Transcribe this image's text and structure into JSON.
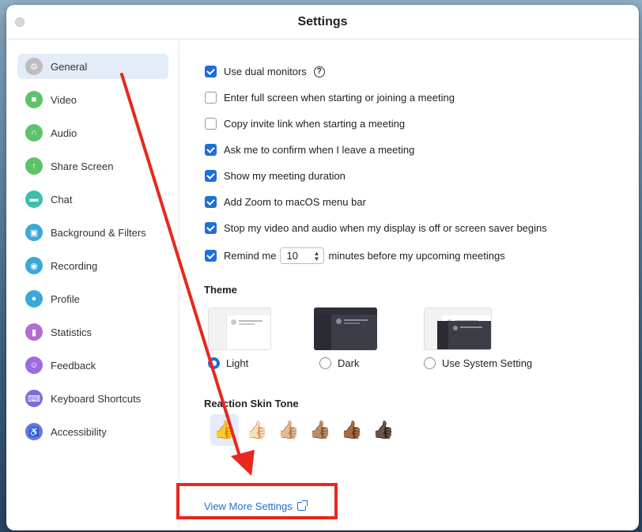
{
  "window": {
    "title": "Settings"
  },
  "sidebar": {
    "items": [
      {
        "label": "General",
        "icon": "gear-icon",
        "color": "#bdbdbd"
      },
      {
        "label": "Video",
        "icon": "video-icon",
        "color": "#5cc36b"
      },
      {
        "label": "Audio",
        "icon": "headphones-icon",
        "color": "#5cc36b"
      },
      {
        "label": "Share Screen",
        "icon": "share-screen-icon",
        "color": "#5cc36b"
      },
      {
        "label": "Chat",
        "icon": "chat-icon",
        "color": "#3fbfaa"
      },
      {
        "label": "Background & Filters",
        "icon": "background-icon",
        "color": "#3aa8d8"
      },
      {
        "label": "Recording",
        "icon": "recording-icon",
        "color": "#3aa8d8"
      },
      {
        "label": "Profile",
        "icon": "profile-icon",
        "color": "#3aa8d8"
      },
      {
        "label": "Statistics",
        "icon": "statistics-icon",
        "color": "#b36ccf"
      },
      {
        "label": "Feedback",
        "icon": "feedback-icon",
        "color": "#9a6cdf"
      },
      {
        "label": "Keyboard Shortcuts",
        "icon": "keyboard-icon",
        "color": "#7b6cdf"
      },
      {
        "label": "Accessibility",
        "icon": "accessibility-icon",
        "color": "#6c72df"
      }
    ]
  },
  "general": {
    "options": [
      {
        "label": "Use dual monitors",
        "checked": true
      },
      {
        "label": "Enter full screen when starting or joining a meeting",
        "checked": false
      },
      {
        "label": "Copy invite link when starting a meeting",
        "checked": false
      },
      {
        "label": "Ask me to confirm when I leave a meeting",
        "checked": true
      },
      {
        "label": "Show my meeting duration",
        "checked": true
      },
      {
        "label": "Add Zoom to macOS menu bar",
        "checked": true
      },
      {
        "label": "Stop my video and audio when my display is off or screen saver begins",
        "checked": true
      }
    ],
    "remind": {
      "before": "Remind me",
      "value": "10",
      "after": "minutes before my upcoming meetings",
      "checked": true
    },
    "help_symbol": "?"
  },
  "theme": {
    "heading": "Theme",
    "options": [
      "Light",
      "Dark",
      "Use System Setting"
    ],
    "selected": "Light"
  },
  "reaction": {
    "heading": "Reaction Skin Tone",
    "tones": [
      "👍",
      "👍🏻",
      "👍🏼",
      "👍🏽",
      "👍🏾",
      "👍🏿"
    ],
    "selected": 0
  },
  "footer": {
    "more_link": "View More Settings"
  },
  "colors": {
    "accent": "#1e6fd9",
    "annotation": "#e8281e"
  }
}
